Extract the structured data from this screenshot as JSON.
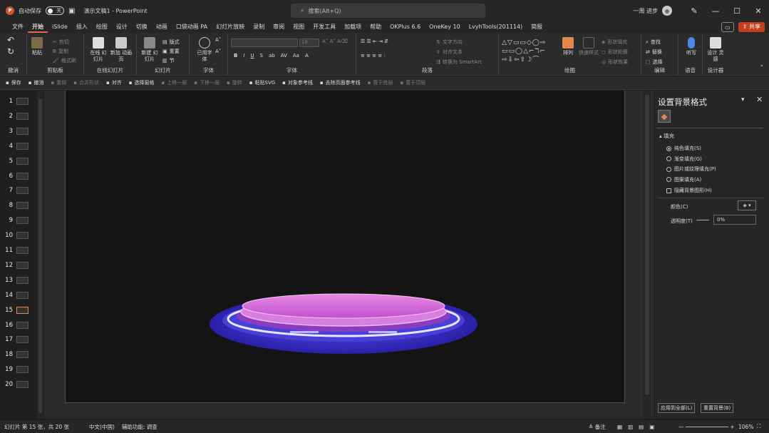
{
  "titlebar": {
    "autosave_label": "自动保存",
    "toggle_state": "关",
    "doc_title": "演示文稿1  -  PowerPoint",
    "search_placeholder": "搜索(Alt+Q)",
    "user_name": "一周 进步"
  },
  "menu": [
    "文件",
    "开始",
    "iSlide",
    "插入",
    "绘图",
    "设计",
    "切换",
    "动画",
    "口袋动画 PA",
    "幻灯片放映",
    "录制",
    "审阅",
    "视图",
    "开发工具",
    "加载项",
    "帮助",
    "OKPlus 6.6",
    "OneKey 10",
    "LvyhTools(201114)",
    "简报"
  ],
  "share_label": "共享",
  "ribbon": {
    "undo_label": "撤消",
    "clipboard": {
      "label": "剪贴板",
      "paste": "粘贴",
      "cut": "剪切",
      "copy": "复制",
      "format": "格式刷"
    },
    "online": {
      "label": "在线幻灯片",
      "btn1": "在线 幻灯片",
      "btn2": "新加 动画页"
    },
    "slides": {
      "label": "幻灯片",
      "new": "新建 幻灯片",
      "layout": "版式",
      "reset": "重置",
      "section": "节"
    },
    "font_group": {
      "label": "字体",
      "use_font": "已用字 体",
      "size": "18"
    },
    "fontgroup_label": "字体",
    "paragraph": {
      "label": "段落",
      "textdir": "文字方向",
      "align": "对齐文本",
      "smartart": "转换为 SmartArt"
    },
    "drawing": {
      "label": "绘图",
      "arrange": "排列",
      "quickstyle": "快速样式",
      "fill": "形状填充",
      "outline": "形状轮廓",
      "effect": "形状效果"
    },
    "editing": {
      "label": "编辑",
      "find": "查找",
      "replace": "替换",
      "select": "选择"
    },
    "voice": {
      "label": "语音",
      "dictate": "听写"
    },
    "designer": {
      "label": "设计器",
      "btn": "设计 灵感"
    }
  },
  "qat": [
    {
      "label": "保存",
      "on": true
    },
    {
      "label": "撤消",
      "on": true
    },
    {
      "label": "重做",
      "on": false
    },
    {
      "label": "合并形状",
      "on": false
    },
    {
      "label": "对齐",
      "on": true
    },
    {
      "label": "选择窗格",
      "on": true
    },
    {
      "label": "上移一层",
      "on": false
    },
    {
      "label": "下移一层",
      "on": false
    },
    {
      "label": "旋转",
      "on": false
    },
    {
      "label": "粘贴SVG",
      "on": true
    },
    {
      "label": "对象参考线",
      "on": true
    },
    {
      "label": "去除页面参考线",
      "on": true
    },
    {
      "label": "置于底层",
      "on": false
    },
    {
      "label": "置于顶层",
      "on": false
    }
  ],
  "thumbnails": [
    "1",
    "2",
    "3",
    "4",
    "5",
    "6",
    "7",
    "8",
    "9",
    "10",
    "11",
    "12",
    "13",
    "14",
    "15",
    "16",
    "17",
    "18",
    "19",
    "20"
  ],
  "selected_slide": 15,
  "pane": {
    "title": "设置背景格式",
    "section": "填充",
    "options": [
      "纯色填充(S)",
      "渐变填充(G)",
      "图片或纹理填充(P)",
      "图案填充(A)"
    ],
    "selected_option": 0,
    "hide_bg": "隐藏背景图形(H)",
    "color_label": "颜色(C)",
    "transparency_label": "透明度(T)",
    "transparency_value": "0%",
    "apply_all": "应用到全部(L)",
    "reset_bg": "重置背景(B)"
  },
  "status": {
    "slide_info": "幻灯片 第 15 张，共 20 张",
    "language": "中文(中国)",
    "accessibility": "辅助功能: 调查",
    "notes": "备注",
    "zoom": "106%"
  }
}
